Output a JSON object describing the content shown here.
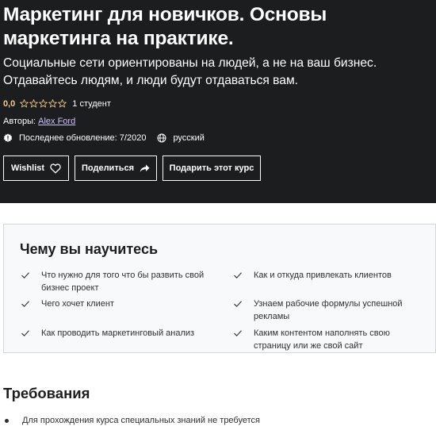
{
  "hero": {
    "title": "Маркетинг для новичков. Основы маркетинга на практике.",
    "subtitle": "Социальные сети ориентированы на людей, а не на ваш бизнес. Отдавайтесь людям, и люди будут отдаваться вам.",
    "rating": "0,0",
    "stars_filled": 0,
    "stars_total": 5,
    "students": "1 студент",
    "authors_label": "Авторы:",
    "author_name": "Alex Ford",
    "last_updated": "Последнее обновление: 7/2020",
    "language": "русский",
    "buttons": {
      "wishlist": "Wishlist",
      "share": "Поделиться",
      "gift": "Подарить этот курс"
    }
  },
  "learn": {
    "title": "Чему вы научитесь",
    "items": [
      "Что нужно для того что бы развить свой бизнес проект",
      "Как и откуда привлекать клиентов",
      "Чего хочет клиент",
      "Узнаем рабочие формулы успешной рекламы",
      "Как проводить маркетинговый анализ",
      "Каким контентом наполнять свою страницу или же свой сайт"
    ]
  },
  "requirements": {
    "title": "Требования",
    "items": [
      "Для прохождения курса специальных знаний не требуется"
    ]
  },
  "colors": {
    "hero_bg": "#1c1d1f",
    "rating": "#f3ca8c",
    "link": "#cec0fc",
    "box_bg": "#f7f9fa"
  }
}
